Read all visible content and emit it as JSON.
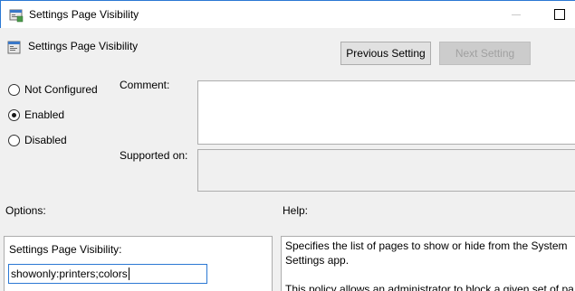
{
  "window": {
    "title": "Settings Page Visibility"
  },
  "header": {
    "title": "Settings Page Visibility",
    "prev_label": "Previous Setting",
    "next_label": "Next Setting"
  },
  "state_options": [
    {
      "label": "Not Configured",
      "checked": false
    },
    {
      "label": "Enabled",
      "checked": true
    },
    {
      "label": "Disabled",
      "checked": false
    }
  ],
  "fields": {
    "comment_label": "Comment:",
    "supported_label": "Supported on:"
  },
  "sections": {
    "options_label": "Options:",
    "help_label": "Help:"
  },
  "options": {
    "field_label": "Settings Page Visibility:",
    "field_value": "showonly:printers;colors"
  },
  "help": {
    "line1": "Specifies the list of pages to show or hide from the System Settings app.",
    "line2": "This policy allows an administrator to block a given set of pa"
  },
  "icons": {
    "app": "policy-settings-icon",
    "header": "policy-settings-icon"
  }
}
